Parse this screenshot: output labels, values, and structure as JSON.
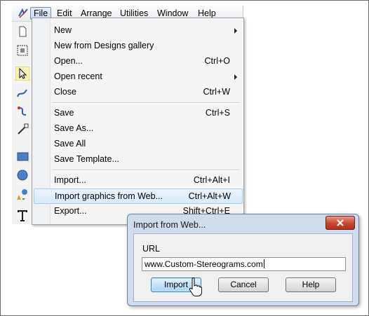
{
  "menubar": {
    "items": [
      "File",
      "Edit",
      "Arrange",
      "Utilities",
      "Window",
      "Help"
    ],
    "active": "File"
  },
  "file_menu": {
    "new": {
      "label": "New",
      "submenu": true
    },
    "new_from_gallery": {
      "label": "New from Designs gallery"
    },
    "open": {
      "label": "Open...",
      "shortcut": "Ctrl+O"
    },
    "open_recent": {
      "label": "Open recent",
      "submenu": true
    },
    "close": {
      "label": "Close",
      "shortcut": "Ctrl+W"
    },
    "save": {
      "label": "Save",
      "shortcut": "Ctrl+S"
    },
    "save_as": {
      "label": "Save As..."
    },
    "save_all": {
      "label": "Save All"
    },
    "save_template": {
      "label": "Save Template..."
    },
    "import": {
      "label": "Import...",
      "shortcut": "Ctrl+Alt+I"
    },
    "import_web": {
      "label": "Import graphics from Web...",
      "shortcut": "Ctrl+Alt+W",
      "highlighted": true
    },
    "export": {
      "label": "Export...",
      "shortcut": "Shift+Ctrl+E"
    }
  },
  "dialog": {
    "title": "Import from Web...",
    "url_label": "URL",
    "url_value": "www.Custom-Stereograms.com",
    "buttons": {
      "import": "Import",
      "cancel": "Cancel",
      "help": "Help"
    }
  },
  "colors": {
    "highlight": "#d8eafa",
    "close_button": "#c9452e",
    "dialog_frame": "#cfdced"
  },
  "icons": [
    "app-logo-icon",
    "new-document-icon",
    "selection-frame-icon",
    "arrow-tool-icon",
    "pen-tool-icon",
    "bezier-tool-icon",
    "node-tool-icon",
    "rectangle-tool-icon",
    "ellipse-tool-icon",
    "shapes-tool-icon",
    "text-tool-icon",
    "mouse-pointer-icon",
    "close-icon"
  ]
}
